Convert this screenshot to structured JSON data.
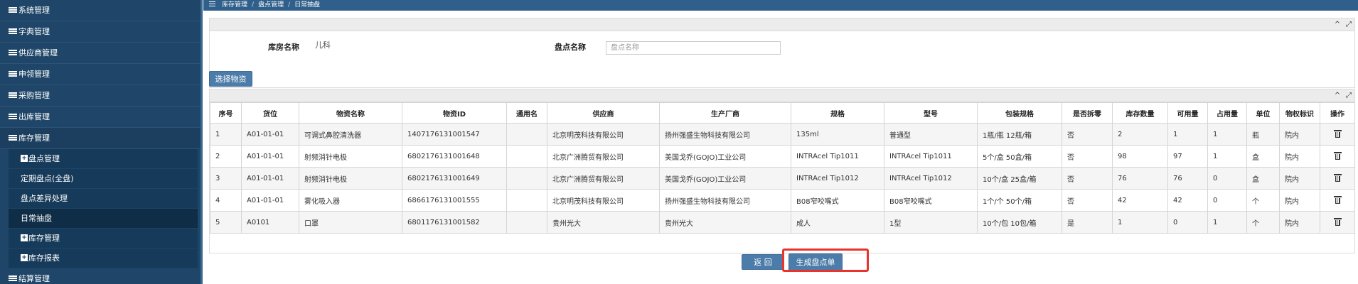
{
  "sidebar": {
    "items": [
      {
        "label": "系统管理"
      },
      {
        "label": "字典管理"
      },
      {
        "label": "供应商管理"
      },
      {
        "label": "申领管理"
      },
      {
        "label": "采购管理"
      },
      {
        "label": "出库管理"
      },
      {
        "label": "库存管理"
      }
    ],
    "submenu": [
      {
        "label": "盘点管理",
        "plus": "+"
      },
      {
        "label": "定期盘点(全盘)"
      },
      {
        "label": "盘点差异处理"
      },
      {
        "label": "日常抽盘"
      },
      {
        "label": "库存管理",
        "plus": "+"
      },
      {
        "label": "库存报表",
        "plus": "+"
      }
    ],
    "last_item": {
      "label": "结算管理"
    }
  },
  "breadcrumb": {
    "items": [
      "库存管理",
      "盘点管理",
      "日常抽盘"
    ],
    "sep": "/"
  },
  "filter": {
    "warehouse_label": "库房名称",
    "warehouse_value": "儿科",
    "stock_name_label": "盘点名称",
    "stock_name_placeholder": "盘点名称",
    "stock_name_value": ""
  },
  "panel_tools": {
    "collapse": "^",
    "expand": "⤢"
  },
  "select_materials_label": "选择物资",
  "table": {
    "headers": [
      "序号",
      "货位",
      "物资名称",
      "物资ID",
      "通用名",
      "供应商",
      "生产厂商",
      "规格",
      "型号",
      "包装规格",
      "是否拆零",
      "库存数量",
      "可用量",
      "占用量",
      "单位",
      "物权标识",
      "操作"
    ],
    "rows": [
      [
        "1",
        "A01-01-01",
        "可调式鼻腔清洗器",
        "1407176131001547",
        "",
        "北京明茂科技有限公司",
        "扬州强盛生物科技有限公司",
        "135ml",
        "普通型",
        "1瓶/瓶 12瓶/箱",
        "否",
        "2",
        "1",
        "1",
        "瓶",
        "院内"
      ],
      [
        "2",
        "A01-01-01",
        "射频消针电极",
        "6802176131001648",
        "",
        "北京广洲腾贸有限公司",
        "美国戈乔(GOJO)工业公司",
        "INTRAcel Tip1011",
        "INTRAcel Tip1011",
        "5个/盒 50盒/箱",
        "否",
        "98",
        "97",
        "1",
        "盒",
        "院内"
      ],
      [
        "3",
        "A01-01-01",
        "射频消针电极",
        "6802176131001649",
        "",
        "北京广洲腾贸有限公司",
        "美国戈乔(GOJO)工业公司",
        "INTRAcel Tip1012",
        "INTRAcel Tip1012",
        "10个/盒 25盒/箱",
        "否",
        "76",
        "76",
        "0",
        "盒",
        "院内"
      ],
      [
        "4",
        "A01-01-01",
        "雾化吸入器",
        "6866176131001555",
        "",
        "北京明茂科技有限公司",
        "扬州强盛生物科技有限公司",
        "B08窄咬嘴式",
        "B08窄咬嘴式",
        "1个/个 50个/箱",
        "否",
        "42",
        "42",
        "0",
        "个",
        "院内"
      ],
      [
        "5",
        "A0101",
        "口罩",
        "6801176131001582",
        "",
        "贵州光大",
        "贵州光大",
        "成人",
        "1型",
        "10个/包 10包/箱",
        "是",
        "1",
        "0",
        "1",
        "个",
        "院内"
      ]
    ]
  },
  "buttons": {
    "back": "返 回",
    "generate": "生成盘点单"
  },
  "colors": {
    "sidebar_bg": "#1f4668",
    "accent": "#4c7ca9",
    "highlight": "#e8342c"
  }
}
